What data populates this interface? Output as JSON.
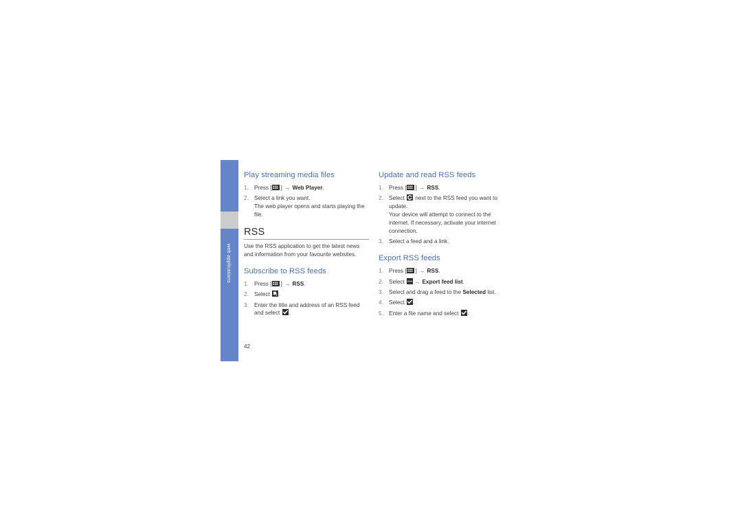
{
  "page": {
    "number": "42",
    "side_tab_label": "web applications"
  },
  "icons": {
    "keypad": "keypad-icon",
    "add_feed": "add-rss-feed-icon",
    "check": "check-icon",
    "refresh": "refresh-icon",
    "options": "options-icon"
  },
  "colors": {
    "heading_blue": "#4a6fb5",
    "side_tab_blue": "#6485c8",
    "side_tab_gap_gray": "#cccccc",
    "body_text": "#3d3d3d",
    "icon_dark": "#2f2f2f"
  },
  "left_column": {
    "section_play": {
      "heading": "Play streaming media files",
      "steps": [
        {
          "pre": "Press [",
          "post": "] ",
          "bold_after": "Web Player",
          "tail": "."
        },
        {
          "text": "Select a link you want.",
          "note": "The web player opens and starts playing the file."
        }
      ]
    },
    "section_rss": {
      "title": "RSS",
      "intro": "Use the RSS application to get the latest news and information from your favourite websites."
    },
    "section_subscribe": {
      "heading": "Subscribe to RSS feeds",
      "step1_pre": "Press [",
      "step1_post": "] ",
      "step1_bold": "RSS",
      "step1_tail": ".",
      "step2_pre": "Select ",
      "step2_tail": ".",
      "step3_pre": "Enter the title and address of an RSS feed and select ",
      "step3_tail": "."
    }
  },
  "right_column": {
    "section_update": {
      "heading": "Update and read RSS feeds",
      "step1_pre": "Press [",
      "step1_post": "] ",
      "step1_bold": "RSS",
      "step1_tail": ".",
      "step2_pre": "Select ",
      "step2_post": " next to the RSS feed you want to update.",
      "step2_note": "Your device will attempt to connect to the internet. If necessary, activate your internet connection.",
      "step3": "Select a feed and a link."
    },
    "section_export": {
      "heading": "Export RSS feeds",
      "step1_pre": "Press [",
      "step1_post": "] ",
      "step1_bold": "RSS",
      "step1_tail": ".",
      "step2_pre": "Select ",
      "step2_mid": " ",
      "step2_bold": "Export feed list",
      "step2_tail": ".",
      "step3_pre": "Select and drag a feed to the ",
      "step3_bold": "Selected",
      "step3_tail": " list.",
      "step4_pre": "Select ",
      "step4_tail": ".",
      "step5_pre": "Enter a file name and select ",
      "step5_tail": "."
    }
  },
  "symbols": {
    "arrow": "→"
  }
}
